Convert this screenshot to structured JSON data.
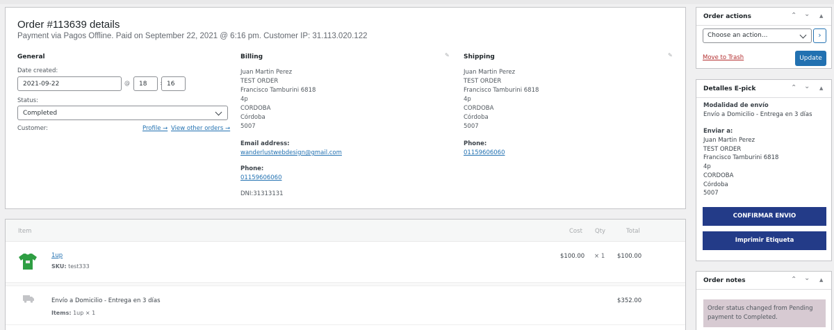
{
  "order": {
    "title": "Order #113639 details",
    "subtitle": "Payment via Pagos Offline. Paid on September 22, 2021 @ 6:16 pm. Customer IP: 31.113.020.122"
  },
  "general": {
    "heading": "General",
    "date_label": "Date created:",
    "date_value": "2021-09-22",
    "at": "@",
    "hour": "18",
    "colon": ":",
    "minute": "16",
    "status_label": "Status:",
    "status_value": "Completed",
    "customer_label": "Customer:",
    "profile_link": "Profile →",
    "other_orders_link": "View other orders →"
  },
  "billing": {
    "heading": "Billing",
    "address": [
      "Juan Martin Perez",
      "TEST ORDER",
      "Francisco Tamburini 6818",
      "4p",
      "CORDOBA",
      "Córdoba",
      "5007"
    ],
    "email_label": "Email address:",
    "email": "wanderlustwebdesign@gmail.com",
    "phone_label": "Phone:",
    "phone": "01159606060",
    "dni": "DNI:31313131"
  },
  "shipping": {
    "heading": "Shipping",
    "address": [
      "Juan Martin Perez",
      "TEST ORDER",
      "Francisco Tamburini 6818",
      "4p",
      "CORDOBA",
      "Córdoba",
      "5007"
    ],
    "phone_label": "Phone:",
    "phone": "01159606060"
  },
  "items": {
    "headers": {
      "item": "Item",
      "cost": "Cost",
      "qty": "Qty",
      "total": "Total"
    },
    "product": {
      "name": "1up",
      "sku_label": "SKU:",
      "sku": "test333",
      "cost": "$100.00",
      "qty": "× 1",
      "total": "$100.00"
    },
    "shipping_line": {
      "name": "Envío a Domicilio - Entrega en 3 días",
      "items_label": "Items:",
      "items_value": "1up × 1",
      "total": "$352.00"
    }
  },
  "order_actions": {
    "title": "Order actions",
    "select_value": "Choose an action...",
    "trash_link": "Move to Trash",
    "update_button": "Update"
  },
  "epick": {
    "title": "Detalles E-pick",
    "modalidad_label": "Modalidad de envío",
    "modalidad_value": "Envío a Domicilio - Entrega en 3 días",
    "enviar_label": "Enviar a:",
    "address": [
      "Juan Martin Perez",
      "TEST ORDER",
      "Francisco Tamburini 6818",
      "4p",
      "CORDOBA",
      "Córdoba",
      "5007"
    ],
    "confirm_button": "CONFIRMAR ENVIO",
    "print_button": "Imprimir Etiqueta"
  },
  "order_notes": {
    "title": "Order notes",
    "note_line1": "Order status changed from Pending",
    "note_line2": "payment to Completed."
  },
  "icons": {
    "product_thumb": "tshirt-icon",
    "shipping": "truck-icon",
    "edit": "pencil-icon"
  },
  "colors": {
    "accent": "#2271b1",
    "navy_button": "#233b88",
    "note_bg": "#d7cad2"
  }
}
